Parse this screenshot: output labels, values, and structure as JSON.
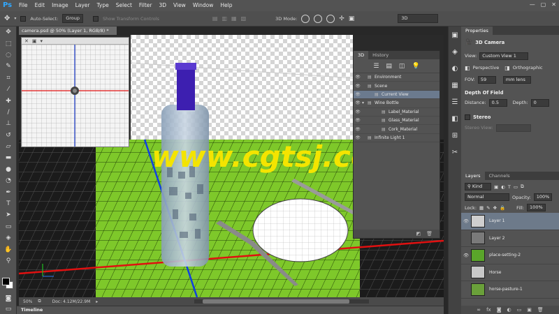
{
  "app": {
    "logo": "Ps"
  },
  "menu": [
    "File",
    "Edit",
    "Image",
    "Layer",
    "Type",
    "Select",
    "Filter",
    "3D",
    "View",
    "Window",
    "Help"
  ],
  "window_controls": [
    "—",
    "▢",
    "✕"
  ],
  "options_bar": {
    "auto_select_label": "Auto-Select:",
    "auto_select_value": "Group",
    "show_transform_label": "Show Transform Controls",
    "mode_label": "3D Mode:",
    "workspace": "3D"
  },
  "document": {
    "tab_title": "camera.psd @ 50% (Layer 1, RGB/8) *",
    "zoom": "50%",
    "doc_size": "Doc: 4.12M/22.9M"
  },
  "watermark": {
    "text": "www.cgtsj.com",
    "color": "#f4e400"
  },
  "timeline_label": "Timeline",
  "panel3d": {
    "tabs": [
      "3D",
      "History"
    ],
    "tree": [
      {
        "label": "Environment",
        "level": 0,
        "selected": false,
        "expand": false
      },
      {
        "label": "Scene",
        "level": 0,
        "selected": false,
        "expand": false
      },
      {
        "label": "Current View",
        "level": 1,
        "selected": true,
        "expand": false
      },
      {
        "label": "Wine Bottle",
        "level": 0,
        "selected": false,
        "expand": true
      },
      {
        "label": "Label_Material",
        "level": 2,
        "selected": false,
        "expand": false
      },
      {
        "label": "Glass_Material",
        "level": 2,
        "selected": false,
        "expand": false
      },
      {
        "label": "Cork_Material",
        "level": 2,
        "selected": false,
        "expand": false
      },
      {
        "label": "Infinite Light 1",
        "level": 0,
        "selected": false,
        "expand": false
      }
    ]
  },
  "properties": {
    "tab": "Properties",
    "title": "3D Camera",
    "view_label": "View:",
    "view_value": "Custom View 1",
    "perspective": "Perspective",
    "orthographic": "Orthographic",
    "fov_label": "FOV:",
    "fov_value": "59",
    "fov_unit": "mm lens",
    "dof_title": "Depth Of Field",
    "distance_label": "Distance:",
    "distance_value": "0.5",
    "depth_label": "Depth:",
    "depth_value": "0",
    "stereo_label": "Stereo",
    "stereo_view_label": "Stereo View:"
  },
  "layers_panel": {
    "tabs": [
      "Layers",
      "Channels"
    ],
    "kind_label": "Kind",
    "blend_mode": "Normal",
    "opacity_label": "Opacity:",
    "opacity_value": "100%",
    "lock_label": "Lock:",
    "fill_label": "Fill:",
    "fill_value": "100%",
    "layers": [
      {
        "name": "Layer 1",
        "visible": true,
        "selected": true,
        "thumb": "#cfcfcf"
      },
      {
        "name": "Layer 2",
        "visible": false,
        "selected": false,
        "thumb": "#7a7a7a"
      },
      {
        "name": "place-setting-2",
        "visible": true,
        "selected": false,
        "thumb": "#5aa52a"
      },
      {
        "name": "Horse",
        "visible": false,
        "selected": false,
        "thumb": "#c8c8c8"
      },
      {
        "name": "horse-pasture-1",
        "visible": false,
        "selected": false,
        "thumb": "#6aa03a"
      }
    ]
  }
}
